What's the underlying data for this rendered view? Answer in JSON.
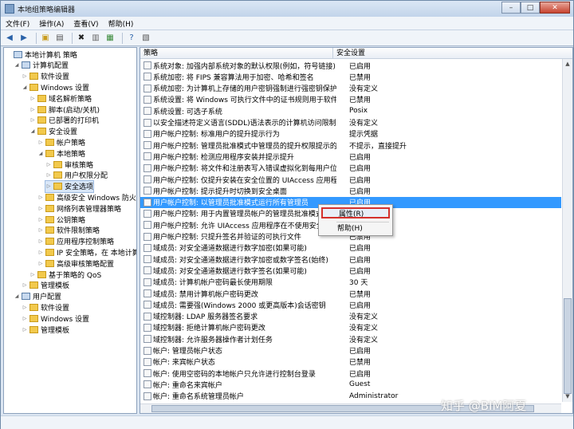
{
  "window": {
    "title": "本地组策略编辑器"
  },
  "menu": [
    "文件(F)",
    "操作(A)",
    "查看(V)",
    "帮助(H)"
  ],
  "toolbar": [
    "back-icon",
    "forward-icon",
    "up-folder-icon",
    "show-tree-icon",
    "delete-icon",
    "properties-icon",
    "export-icon",
    "help-icon",
    "filter-icon"
  ],
  "tree": [
    {
      "label": "本地计算机 策略",
      "depth": 0,
      "icon": "computer"
    },
    {
      "label": "计算机配置",
      "depth": 1,
      "icon": "computer"
    },
    {
      "label": "软件设置",
      "depth": 2,
      "icon": "folder"
    },
    {
      "label": "Windows 设置",
      "depth": 2,
      "icon": "folder"
    },
    {
      "label": "域名解析策略",
      "depth": 3,
      "icon": "folder"
    },
    {
      "label": "脚本(启动/关机)",
      "depth": 3,
      "icon": "folder"
    },
    {
      "label": "已部署的打印机",
      "depth": 3,
      "icon": "folder"
    },
    {
      "label": "安全设置",
      "depth": 3,
      "icon": "folder"
    },
    {
      "label": "帐户策略",
      "depth": 4,
      "icon": "folder"
    },
    {
      "label": "本地策略",
      "depth": 4,
      "icon": "folder"
    },
    {
      "label": "审核策略",
      "depth": 5,
      "icon": "folder"
    },
    {
      "label": "用户权限分配",
      "depth": 5,
      "icon": "folder"
    },
    {
      "label": "安全选项",
      "depth": 5,
      "icon": "folder",
      "selected": true
    },
    {
      "label": "高级安全 Windows 防火墙",
      "depth": 4,
      "icon": "folder"
    },
    {
      "label": "网络列表管理器策略",
      "depth": 4,
      "icon": "folder"
    },
    {
      "label": "公钥策略",
      "depth": 4,
      "icon": "folder"
    },
    {
      "label": "软件限制策略",
      "depth": 4,
      "icon": "folder"
    },
    {
      "label": "应用程序控制策略",
      "depth": 4,
      "icon": "folder"
    },
    {
      "label": "IP 安全策略，在 本地计算机",
      "depth": 4,
      "icon": "folder"
    },
    {
      "label": "高级审核策略配置",
      "depth": 4,
      "icon": "folder"
    },
    {
      "label": "基于策略的 QoS",
      "depth": 3,
      "icon": "folder"
    },
    {
      "label": "管理模板",
      "depth": 2,
      "icon": "folder"
    },
    {
      "label": "用户配置",
      "depth": 1,
      "icon": "computer"
    },
    {
      "label": "软件设置",
      "depth": 2,
      "icon": "folder"
    },
    {
      "label": "Windows 设置",
      "depth": 2,
      "icon": "folder"
    },
    {
      "label": "管理模板",
      "depth": 2,
      "icon": "folder"
    }
  ],
  "columns": {
    "policy": "策略",
    "setting": "安全设置"
  },
  "rows": [
    {
      "policy": "系统对象: 加强内部系统对象的默认权限(例如，符号链接)",
      "setting": "已启用"
    },
    {
      "policy": "系统加密: 将 FIPS 兼容算法用于加密、哈希和签名",
      "setting": "已禁用"
    },
    {
      "policy": "系统加密: 为计算机上存储的用户密钥强制进行强密钥保护",
      "setting": "没有定义"
    },
    {
      "policy": "系统设置: 将 Windows 可执行文件中的证书规则用于软件...",
      "setting": "已禁用"
    },
    {
      "policy": "系统设置: 可选子系统",
      "setting": "Posix"
    },
    {
      "policy": "以安全描述符定义语言(SDDL)语法表示的计算机访问限制",
      "setting": "没有定义"
    },
    {
      "policy": "用户帐户控制: 标准用户的提升提示行为",
      "setting": "提示凭据"
    },
    {
      "policy": "用户帐户控制: 管理员批准模式中管理员的提升权限提示的...",
      "setting": "不提示，直接提升"
    },
    {
      "policy": "用户帐户控制: 检测应用程序安装并提示提升",
      "setting": "已启用"
    },
    {
      "policy": "用户帐户控制: 将文件和注册表写入错误虚拟化到每用户位置",
      "setting": "已启用"
    },
    {
      "policy": "用户帐户控制: 仅提升安装在安全位置的 UIAccess 应用程序",
      "setting": "已启用"
    },
    {
      "policy": "用户帐户控制: 提示提升时切换到安全桌面",
      "setting": "已启用"
    },
    {
      "policy": "用户帐户控制: 以管理员批准模式运行所有管理员",
      "setting": "已启用",
      "highlight": true
    },
    {
      "policy": "用户帐户控制: 用于内置管理员帐户的管理员批准模式",
      "setting": "已禁用"
    },
    {
      "policy": "用户帐户控制: 允许 UIAccess 应用程序在不使用安全桌面...",
      "setting": "已禁用"
    },
    {
      "policy": "用户帐户控制: 只提升签名并验证的可执行文件",
      "setting": "已禁用"
    },
    {
      "policy": "域成员: 对安全通道数据进行数字加密(如果可能)",
      "setting": "已启用"
    },
    {
      "policy": "域成员: 对安全通道数据进行数字加密或数字签名(始终)",
      "setting": "已启用"
    },
    {
      "policy": "域成员: 对安全通道数据进行数字签名(如果可能)",
      "setting": "已启用"
    },
    {
      "policy": "域成员: 计算机帐户密码最长使用期限",
      "setting": "30 天"
    },
    {
      "policy": "域成员: 禁用计算机帐户密码更改",
      "setting": "已禁用"
    },
    {
      "policy": "域成员: 需要强(Windows 2000 或更高版本)会话密钥",
      "setting": "已启用"
    },
    {
      "policy": "域控制器: LDAP 服务器签名要求",
      "setting": "没有定义"
    },
    {
      "policy": "域控制器: 拒绝计算机帐户密码更改",
      "setting": "没有定义"
    },
    {
      "policy": "域控制器: 允许服务器操作者计划任务",
      "setting": "没有定义"
    },
    {
      "policy": "帐户: 管理员帐户状态",
      "setting": "已启用"
    },
    {
      "policy": "帐户: 来宾帐户状态",
      "setting": "已禁用"
    },
    {
      "policy": "帐户: 使用空密码的本地帐户只允许进行控制台登录",
      "setting": "已启用"
    },
    {
      "policy": "帐户: 重命名来宾帐户",
      "setting": "Guest"
    },
    {
      "policy": "帐户: 重命名系统管理员帐户",
      "setting": "Administrator"
    }
  ],
  "context_menu": {
    "properties": "属性(R)",
    "help": "帮助(H)"
  },
  "watermark": "知乎 @BIM阿夏"
}
